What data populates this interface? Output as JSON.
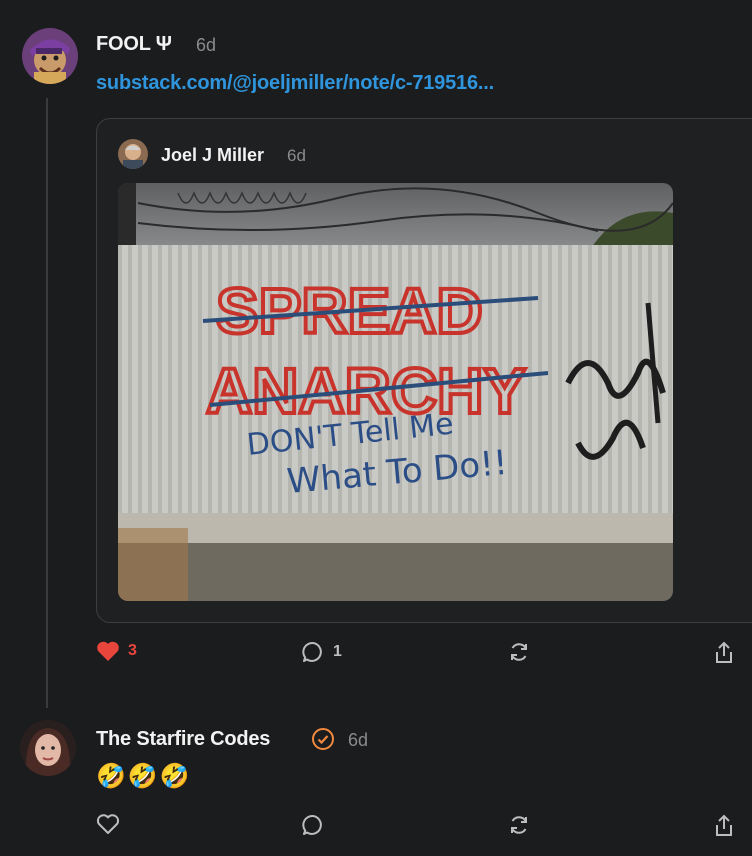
{
  "post": {
    "author": "FOOL Ψ",
    "time": "6d",
    "link_text": "substack.com/@joeljmiller/note/c-719516...",
    "quoted": {
      "author": "Joel J Miller",
      "time": "6d",
      "image_text": {
        "strike_line_1": "SPREAD",
        "strike_line_2": "ANARCHY",
        "line_1": "DON'T Tell Me",
        "line_2": "What To Do!!"
      }
    },
    "actions": {
      "likes": "3",
      "comments": "1"
    }
  },
  "reply": {
    "author": "The Starfire Codes",
    "time": "6d",
    "text": "🤣🤣🤣"
  },
  "colors": {
    "accent_link": "#2f95dc",
    "like_red": "#e8453c",
    "verified_orange": "#f0883e",
    "background": "#1b1c1e"
  }
}
